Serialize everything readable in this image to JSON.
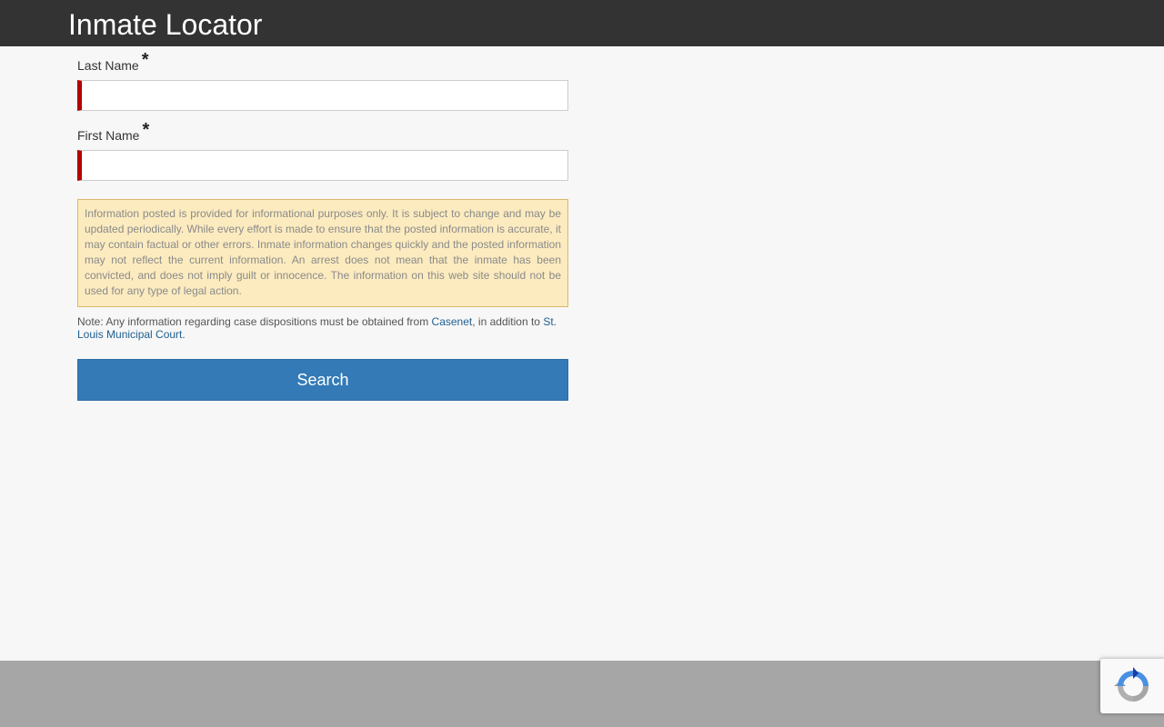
{
  "header": {
    "title": "Inmate Locator"
  },
  "form": {
    "last_name_label": "Last Name",
    "first_name_label": "First Name",
    "required_marker": "*",
    "last_name_value": "",
    "first_name_value": ""
  },
  "disclaimer": {
    "text": "Information posted is provided for informational purposes only. It is subject to change and may be updated periodically. While every effort is made to ensure that the posted information is accurate, it may contain factual or other errors. Inmate information changes quickly and the posted information may not reflect the current information. An arrest does not mean that the inmate has been convicted, and does not imply guilt or innocence. The information on this web site should not be used for any type of legal action."
  },
  "note": {
    "prefix": "Note: Any information regarding case dispositions must be obtained from ",
    "casenet_link": "Casenet",
    "middle": ", in addition to ",
    "court_link": "St. Louis Municipal Court",
    "suffix": "."
  },
  "search_button": {
    "label": "Search"
  },
  "icons": {
    "recaptcha": "recaptcha-icon"
  },
  "colors": {
    "header_bg": "#333333",
    "required_accent": "#b30000",
    "disclaimer_bg": "#fcebbf",
    "button_bg": "#337ab7",
    "link": "#1f5f8f",
    "footer_bg": "#a6a6a6"
  }
}
